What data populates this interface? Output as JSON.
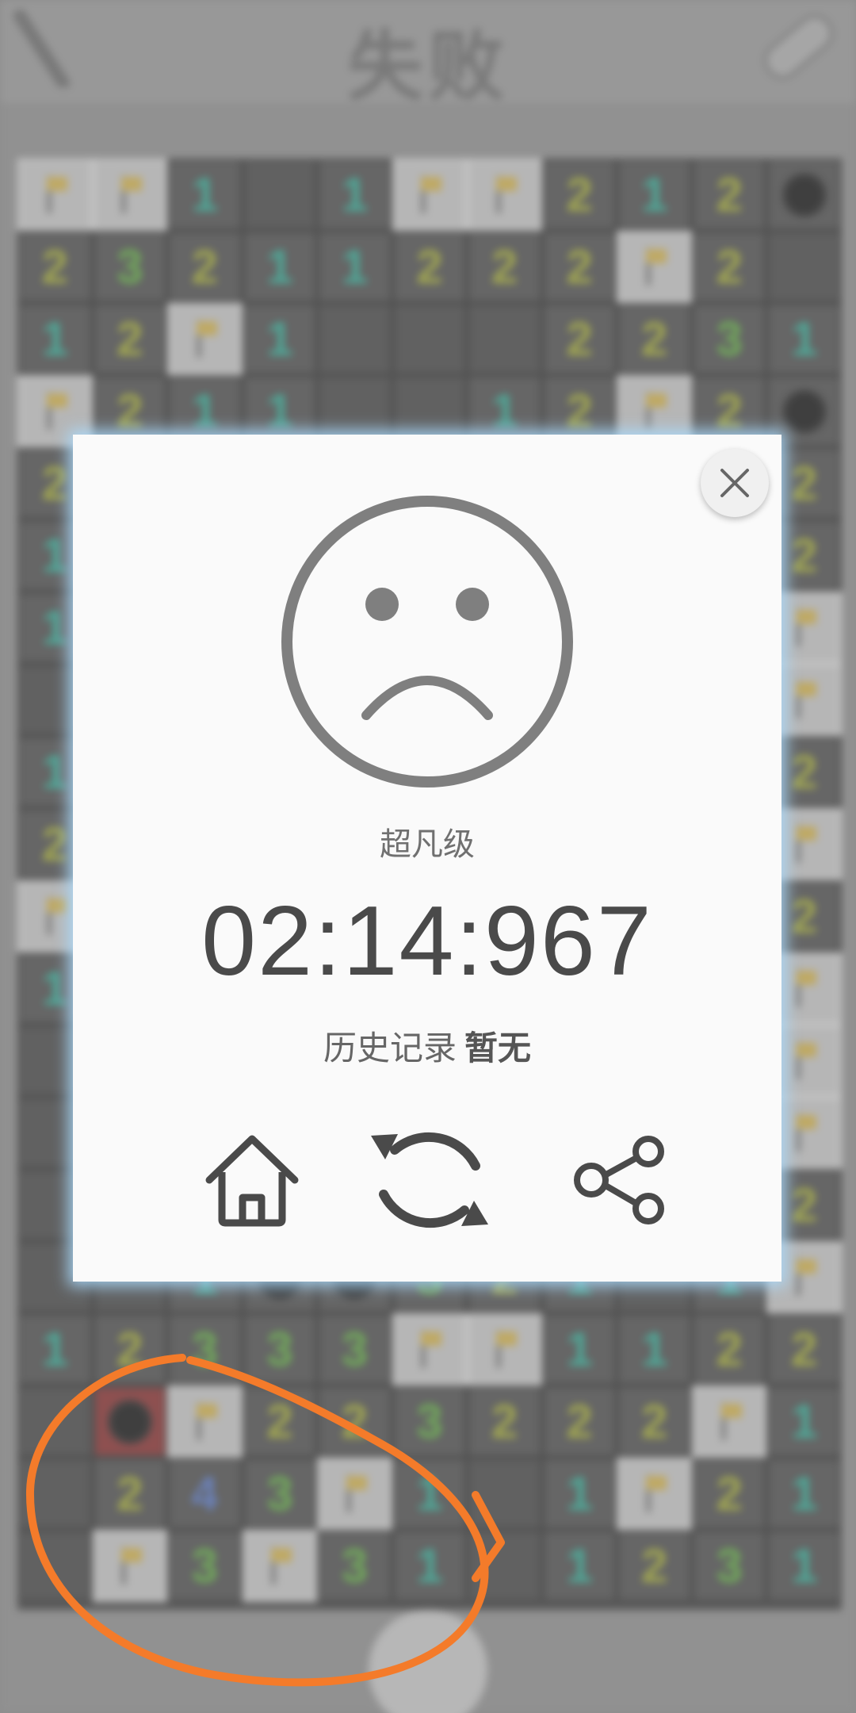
{
  "header": {
    "title": "失败"
  },
  "board": {
    "rows": [
      [
        "F",
        "F",
        "1",
        "",
        "1",
        "F",
        "F",
        "2",
        "1",
        "2",
        "M"
      ],
      [
        "2",
        "3",
        "2",
        "1",
        "1",
        "2",
        "2",
        "2",
        "F",
        "2",
        ""
      ],
      [
        "1",
        "2",
        "F",
        "1",
        "",
        "",
        "",
        "2",
        "2",
        "3",
        "1"
      ],
      [
        "F",
        "2",
        "1",
        "1",
        "",
        "",
        "1",
        "2",
        "F",
        "2",
        "M"
      ],
      [
        "2",
        "",
        "",
        "",
        "",
        "",
        "",
        "",
        "",
        "",
        "2"
      ],
      [
        "1",
        "",
        "",
        "",
        "",
        "",
        "",
        "",
        "",
        "",
        "2"
      ],
      [
        "1",
        "",
        "",
        "",
        "",
        "",
        "",
        "",
        "",
        "",
        "F"
      ],
      [
        "",
        "",
        "",
        "",
        "",
        "",
        "",
        "",
        "",
        "",
        "F"
      ],
      [
        "1",
        "",
        "",
        "",
        "",
        "",
        "",
        "",
        "",
        "",
        "2"
      ],
      [
        "2",
        "",
        "",
        "",
        "",
        "",
        "",
        "",
        "",
        "",
        "F"
      ],
      [
        "F",
        "",
        "",
        "",
        "",
        "",
        "",
        "",
        "",
        "",
        "2"
      ],
      [
        "1",
        "",
        "",
        "",
        "",
        "",
        "",
        "",
        "",
        "",
        "F"
      ],
      [
        "",
        "",
        "",
        "",
        "",
        "",
        "",
        "",
        "",
        "",
        "F"
      ],
      [
        "",
        "",
        "",
        "",
        "",
        "",
        "",
        "",
        "",
        "",
        "F"
      ],
      [
        "",
        "",
        "",
        "",
        "",
        "",
        "",
        "",
        "",
        "",
        "2"
      ],
      [
        "",
        "",
        "1",
        "M",
        "M",
        "3",
        "2",
        "1",
        "",
        "1",
        "F"
      ],
      [
        "1",
        "2",
        "3",
        "3",
        "3",
        "F",
        "F",
        "1",
        "1",
        "2",
        "2"
      ],
      [
        "",
        "X",
        "F",
        "2",
        "2",
        "3",
        "2",
        "2",
        "2",
        "F",
        "1"
      ],
      [
        "",
        "2",
        "4",
        "3",
        "F",
        "1",
        "",
        "1",
        "F",
        "2",
        "1"
      ],
      [
        "",
        "F",
        "3",
        "F",
        "3",
        "1",
        "",
        "1",
        "2",
        "3",
        "1"
      ]
    ]
  },
  "dialog": {
    "level": "超凡级",
    "time": "02:14:967",
    "history_label": "历史记录",
    "history_value": "暂无",
    "close_icon": "close-icon",
    "result_icon": "sad-face-icon",
    "actions": {
      "home_icon": "home-icon",
      "restart_icon": "restart-icon",
      "share_icon": "share-icon"
    }
  },
  "colors": {
    "annotation": "#f47b2a",
    "dialog_glow": "#aee0ff",
    "face": "#7f7f7f"
  }
}
